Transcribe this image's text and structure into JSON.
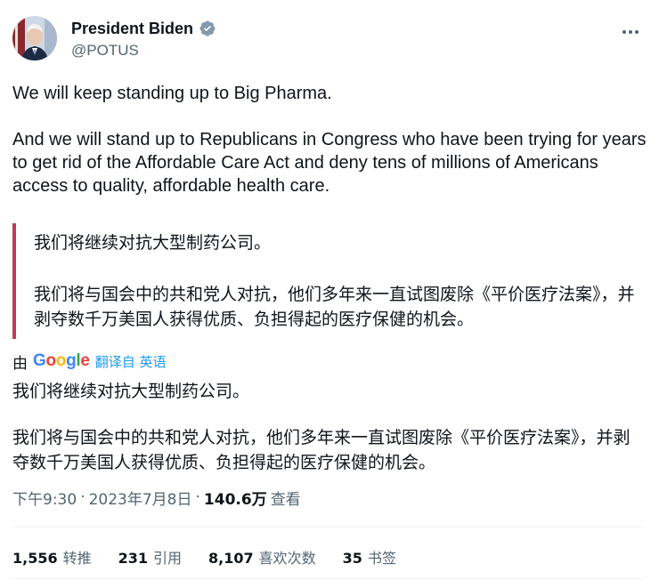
{
  "author": {
    "display_name": "President Biden",
    "handle": "@POTUS"
  },
  "tweet": {
    "paragraph_1": "We will keep standing up to Big Pharma.",
    "paragraph_2": "And we will stand up to Republicans in Congress who have been trying for years to get rid of the Affordable Care Act and deny tens of millions of Americans access to quality, affordable health care."
  },
  "quoted_translation": {
    "line_1": "我们将继续对抗大型制药公司。",
    "line_2": "我们将与国会中的共和党人对抗，他们多年来一直试图废除《平价医疗法案》，并剥夺数千万美国人获得优质、负担得起的医疗保健的机会。"
  },
  "translation_bar": {
    "prefix": "由",
    "provider": "Google",
    "link_text": "翻译自 英语"
  },
  "translation": {
    "line_1": "我们将继续对抗大型制药公司。",
    "line_2": "我们将与国会中的共和党人对抗，他们多年来一直试图废除《平价医疗法案》，并剥夺数千万美国人获得优质、负担得起的医疗保健的机会。"
  },
  "meta": {
    "time": "下午9:30",
    "date": "2023年7月8日",
    "separator": "·",
    "views_count": "140.6万",
    "views_label": "查看"
  },
  "stats": [
    {
      "count": "1,556",
      "label": "转推"
    },
    {
      "count": "231",
      "label": "引用"
    },
    {
      "count": "8,107",
      "label": "喜欢次数"
    },
    {
      "count": "35",
      "label": "书签"
    }
  ],
  "colors": {
    "verified": "#829aab",
    "quote_bar": "#c23a57",
    "link": "#1d9bf0",
    "muted": "#536471"
  },
  "icons": {
    "verified": "verified-badge-icon",
    "more": "more-horizontal-icon"
  }
}
